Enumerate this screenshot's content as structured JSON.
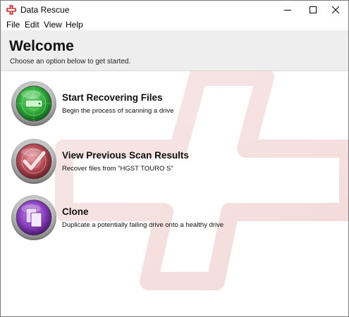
{
  "window": {
    "title": "Data Rescue",
    "app_icon": "data-rescue-logo-icon",
    "controls": {
      "minimize_icon": "minimize-icon",
      "maximize_icon": "maximize-icon",
      "close_icon": "close-icon"
    }
  },
  "menu": {
    "items": [
      {
        "label": "File"
      },
      {
        "label": "Edit"
      },
      {
        "label": "View"
      },
      {
        "label": "Help"
      }
    ]
  },
  "header": {
    "title": "Welcome",
    "subtitle": "Choose an option below to get started."
  },
  "options": [
    {
      "title": "Start Recovering Files",
      "description": "Begin the process of scanning a drive",
      "icon": "radar-drive-icon",
      "color": "#2faa3a"
    },
    {
      "title": "View Previous Scan Results",
      "description": "Recover files from \"HGST TOURO S\"",
      "icon": "checkmark-radar-icon",
      "color": "#b34a55"
    },
    {
      "title": "Clone",
      "description": "Duplicate a potentially failing drive onto a healthy drive",
      "icon": "clone-documents-icon",
      "color": "#8a3fc0"
    }
  ],
  "colors": {
    "brand": "#d42a2a",
    "header_bg": "#eeeeee",
    "watermark": "#f3dcdc"
  }
}
